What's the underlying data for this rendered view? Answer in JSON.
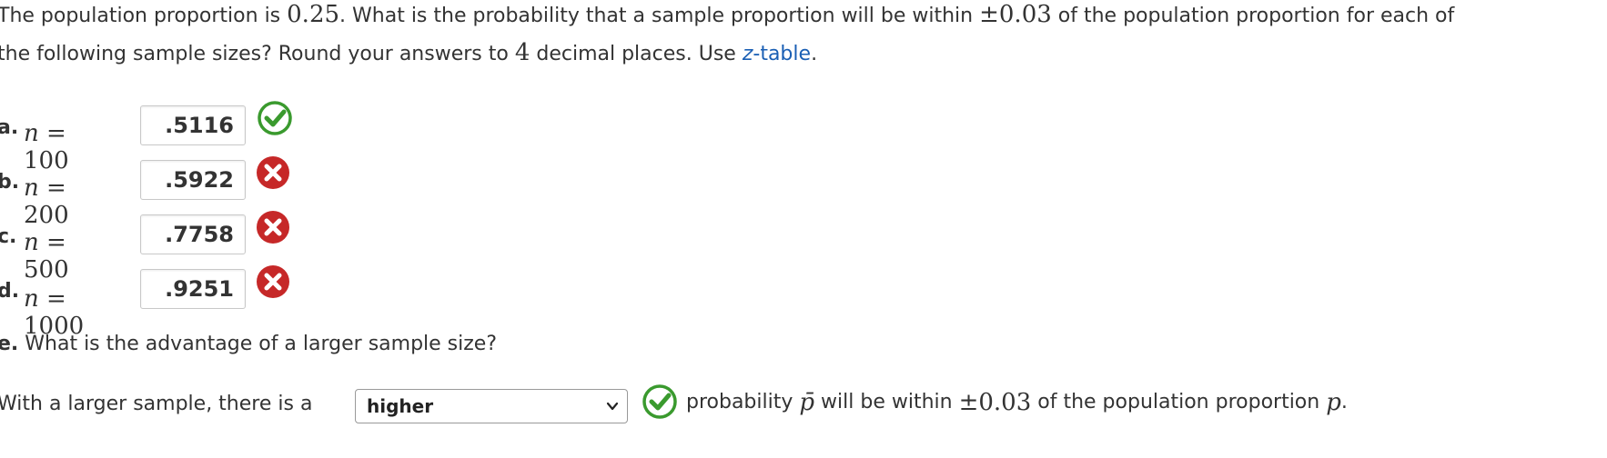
{
  "question": {
    "line1_pre": "The population proportion is ",
    "pop_value": "0.25",
    "line1_mid": ". What is the probability that a sample proportion will be within ",
    "pm_value": "±0.03",
    "line1_post": " of the population proportion for each of",
    "line2_pre": "the following sample sizes? Round your answers to ",
    "decimals": "4",
    "line2_mid": " decimal places. Use ",
    "link_z": "z",
    "link_rest": "-table",
    "line2_end": "."
  },
  "parts": [
    {
      "letter": "a.",
      "n_var": "n",
      "eq_rest": " = 100",
      "answer": ".5116",
      "status": "correct"
    },
    {
      "letter": "b.",
      "n_var": "n",
      "eq_rest": " = 200",
      "answer": ".5922",
      "status": "incorrect"
    },
    {
      "letter": "c.",
      "n_var": "n",
      "eq_rest": " = 500",
      "answer": ".7758",
      "status": "incorrect"
    },
    {
      "letter": "d.",
      "n_var": "n",
      "eq_rest": " = 1000",
      "answer": ".9251",
      "status": "incorrect"
    }
  ],
  "part_e": {
    "letter": "e.",
    "question": " What is the advantage of a larger sample size?",
    "sentence_pre": "With a larger sample, there is a ",
    "select_value": "higher",
    "status": "correct",
    "post_1": "probability ",
    "pbar": "p̄",
    "post_2": " will be within ",
    "pm": "±0.03",
    "post_3": " of the population proportion ",
    "p": "p",
    "post_4": "."
  },
  "colors": {
    "correct": "#3a9a2e",
    "incorrect": "#c62828",
    "link": "#1a5fb4"
  },
  "icons": {
    "correct": "check-circle-icon",
    "incorrect": "x-circle-icon",
    "select": "chevron-down-icon"
  }
}
